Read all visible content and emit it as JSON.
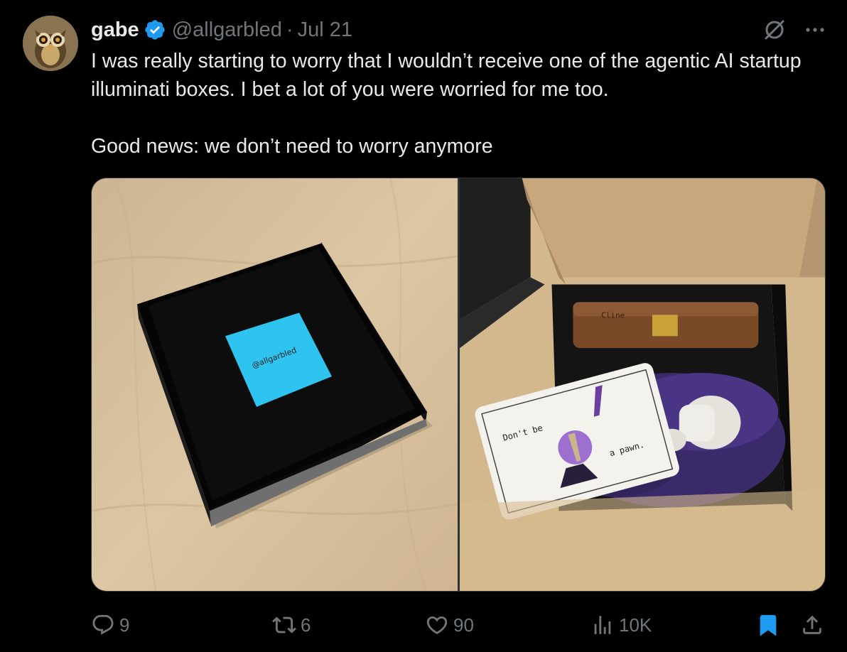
{
  "author": {
    "display_name": "gabe",
    "handle": "@allgarbled",
    "separator": "·",
    "date": "Jul 21",
    "verified": true
  },
  "tweet": {
    "line1": "I was really starting to worry that I wouldn’t receive one of the agentic AI startup illuminati boxes. I bet a lot of you were worried for me too.",
    "line2": "Good news: we don’t need to worry anymore"
  },
  "media": {
    "photo1": {
      "sticky_note_text": "@allgarbled"
    },
    "photo2": {
      "wood_box_label": "Cline",
      "card_text_1": "Don't be",
      "card_text_2": "a pawn."
    }
  },
  "actions": {
    "replies": "9",
    "reposts": "6",
    "likes": "90",
    "views": "10K"
  },
  "colors": {
    "background": "#000000",
    "text": "#e7e9ea",
    "muted": "#71767b",
    "verified": "#1d9bf0",
    "bookmark_active": "#1d9bf0"
  },
  "icons": {
    "top_right": [
      "grok-icon",
      "more-icon"
    ],
    "actions": [
      "reply-icon",
      "repost-icon",
      "like-icon",
      "views-icon",
      "bookmark-icon",
      "share-icon"
    ]
  }
}
